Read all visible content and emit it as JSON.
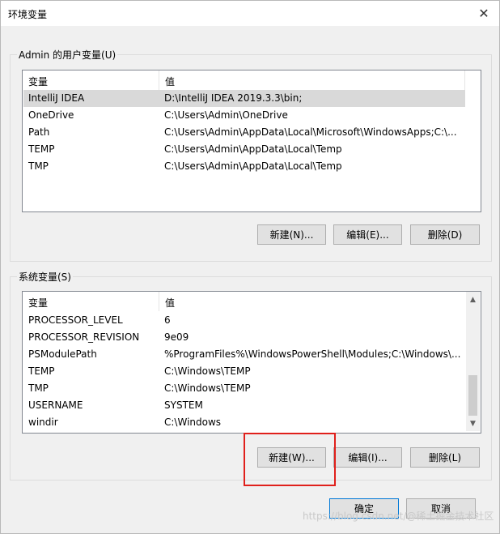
{
  "window": {
    "title": "环境变量",
    "close": "✕"
  },
  "user_vars": {
    "group_label": "Admin 的用户变量(U)",
    "header": {
      "name": "变量",
      "value": "值"
    },
    "rows": [
      {
        "name": "IntelliJ IDEA",
        "value": "D:\\IntelliJ IDEA 2019.3.3\\bin;",
        "selected": true
      },
      {
        "name": "OneDrive",
        "value": "C:\\Users\\Admin\\OneDrive"
      },
      {
        "name": "Path",
        "value": "C:\\Users\\Admin\\AppData\\Local\\Microsoft\\WindowsApps;C:\\..."
      },
      {
        "name": "TEMP",
        "value": "C:\\Users\\Admin\\AppData\\Local\\Temp"
      },
      {
        "name": "TMP",
        "value": "C:\\Users\\Admin\\AppData\\Local\\Temp"
      }
    ],
    "buttons": {
      "new": "新建(N)...",
      "edit": "编辑(E)...",
      "delete": "删除(D)"
    }
  },
  "system_vars": {
    "group_label": "系统变量(S)",
    "header": {
      "name": "变量",
      "value": "值"
    },
    "rows": [
      {
        "name": "PROCESSOR_LEVEL",
        "value": "6"
      },
      {
        "name": "PROCESSOR_REVISION",
        "value": "9e09"
      },
      {
        "name": "PSModulePath",
        "value": "%ProgramFiles%\\WindowsPowerShell\\Modules;C:\\Windows\\..."
      },
      {
        "name": "TEMP",
        "value": "C:\\Windows\\TEMP"
      },
      {
        "name": "TMP",
        "value": "C:\\Windows\\TEMP"
      },
      {
        "name": "USERNAME",
        "value": "SYSTEM"
      },
      {
        "name": "windir",
        "value": "C:\\Windows"
      }
    ],
    "buttons": {
      "new": "新建(W)...",
      "edit": "编辑(I)...",
      "delete": "删除(L)"
    },
    "scroll_up": "▲",
    "scroll_down": "▼"
  },
  "footer": {
    "ok": "确定",
    "cancel": "取消"
  },
  "highlight_color": "#e0201b",
  "watermark": "https://blog.csdn.net/@稀土掘金技术社区"
}
